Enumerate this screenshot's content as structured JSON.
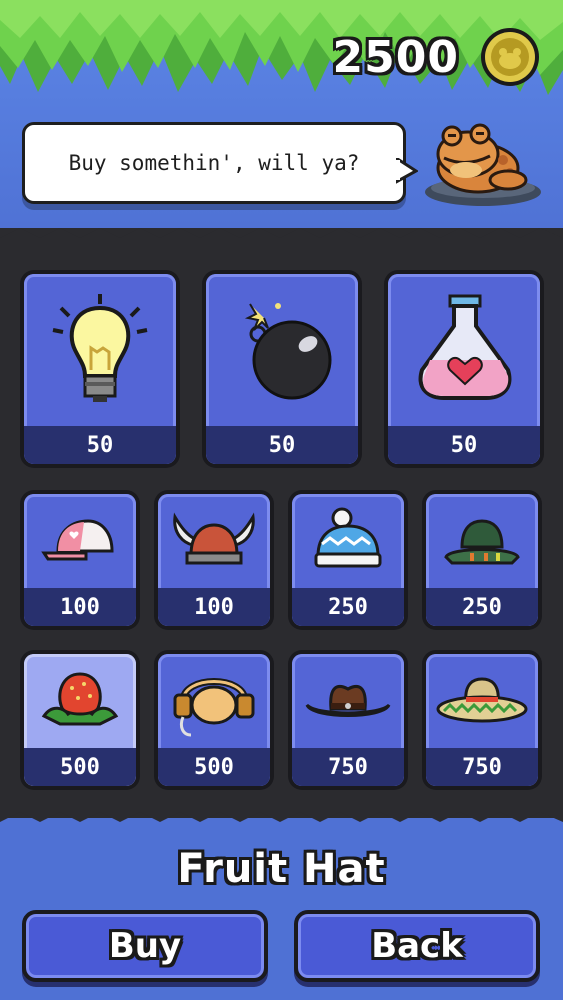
{
  "header": {
    "coins": "2500",
    "coin_icon": "frog-coin-icon"
  },
  "shopkeeper": {
    "dialogue": "Buy somethin', will ya?",
    "icon": "toad-shopkeeper-icon"
  },
  "shop": {
    "consumables": [
      {
        "icon": "lightbulb-icon",
        "price": "50"
      },
      {
        "icon": "bomb-icon",
        "price": "50"
      },
      {
        "icon": "heart-potion-icon",
        "price": "50"
      }
    ],
    "hats_row1": [
      {
        "icon": "baseball-cap-icon",
        "price": "100"
      },
      {
        "icon": "viking-helmet-icon",
        "price": "100"
      },
      {
        "icon": "beanie-icon",
        "price": "250"
      },
      {
        "icon": "bucket-hat-icon",
        "price": "250"
      }
    ],
    "hats_row2": [
      {
        "icon": "fruit-hat-icon",
        "price": "500",
        "selected": true
      },
      {
        "icon": "headphones-icon",
        "price": "500"
      },
      {
        "icon": "cowboy-hat-icon",
        "price": "750"
      },
      {
        "icon": "sombrero-icon",
        "price": "750"
      }
    ]
  },
  "selected_item": {
    "name": "Fruit Hat"
  },
  "buttons": {
    "buy": "Buy",
    "back": "Back"
  },
  "colors": {
    "background": "#4f71d4",
    "card": "#5465d6",
    "card_selected": "#9ea9f2",
    "price_bar": "#28306e",
    "panel": "#2b2b2f"
  }
}
